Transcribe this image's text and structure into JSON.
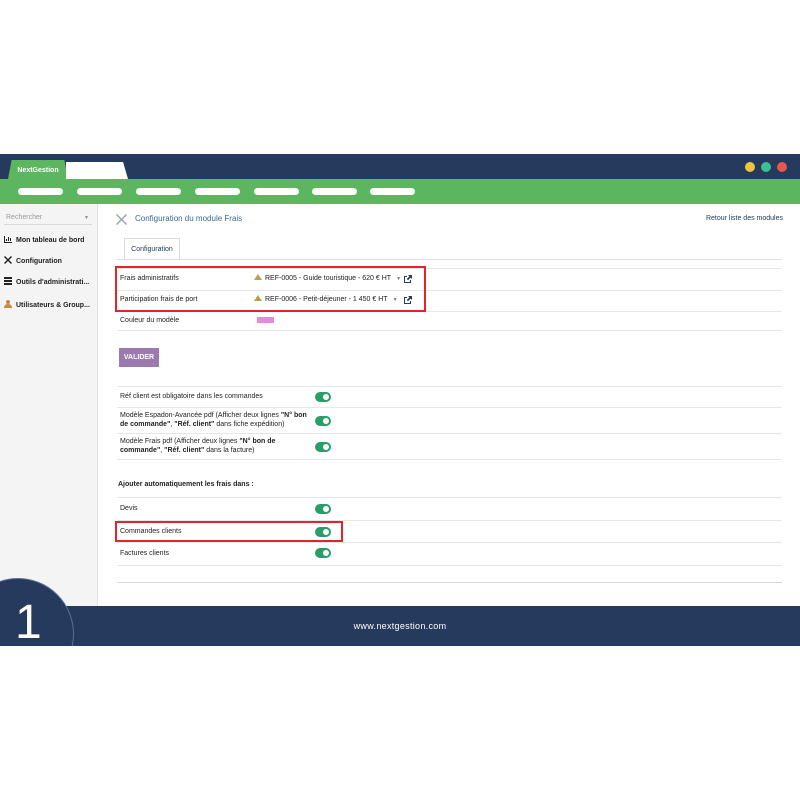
{
  "window": {
    "tab_label": "NextGestion",
    "dots": [
      "#f3c33d",
      "#3dbf94",
      "#e8574e"
    ]
  },
  "sidebar": {
    "search_placeholder": "Rechercher",
    "items": [
      {
        "label": "Mon tableau de bord",
        "icon": "chart-icon"
      },
      {
        "label": "Configuration",
        "icon": "tools-icon"
      },
      {
        "label": "Outils d'administrati...",
        "icon": "server-icon"
      },
      {
        "label": "Utilisateurs & Group...",
        "icon": "user-icon"
      }
    ]
  },
  "main": {
    "module_title": "Configuration du module Frais",
    "back_link": "Retour liste des modules",
    "tab_label": "Configuration",
    "fees": [
      {
        "label": "Frais administratifs",
        "value": "REF-0005 - Guide touristique - 620 € HT"
      },
      {
        "label": "Participation frais de port",
        "value": "REF-0006 - Petit-déjeuner - 1 450 € HT"
      }
    ],
    "color_label": "Couleur du modèle",
    "color_value": "#e38ad8",
    "submit_label": "VALIDER",
    "options": {
      "ref_client_label": "Réf client est obligatoire dans les commandes",
      "espadon_prefix": "Modèle Espadon-Avancée pdf (Afficher deux lignes ",
      "espadon_bold1": "\"N° bon de commande\"",
      "espadon_sep": ", ",
      "espadon_bold2": "\"Réf. client\"",
      "espadon_suffix": " dans fiche expédition)",
      "frais_prefix": "Modèle Frais pdf (Afficher deux lignes ",
      "frais_bold1": "\"N° bon de commande\"",
      "frais_sep": ", ",
      "frais_bold2": "\"Réf. client\"",
      "frais_suffix": " dans la facture)"
    },
    "auto_title": "Ajouter automatiquement les frais dans :",
    "auto_items": [
      "Devis",
      "Commandes clients",
      "Factures clients"
    ]
  },
  "footer": {
    "url": "www.nextgestion.com",
    "badge_number": "1"
  }
}
